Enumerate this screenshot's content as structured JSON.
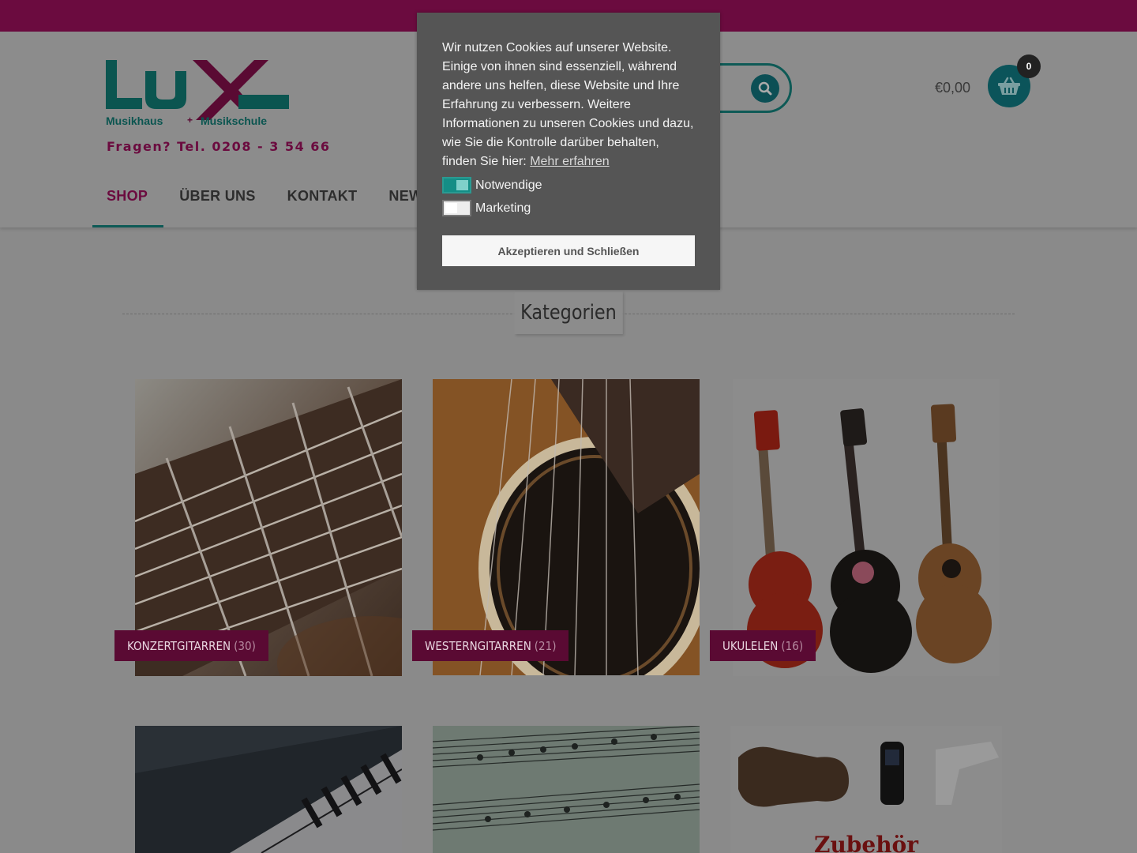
{
  "colors": {
    "brand_primary": "#6b0b3f",
    "brand_teal": "#0e5a56",
    "overlay": "#555555"
  },
  "logo": {
    "wordmark": "LUX",
    "left_text": "Musikhaus",
    "plus": "+",
    "right_text": "Musikschule"
  },
  "header": {
    "phone_text": "Fragen? Tel. 0208 - 3 54 66",
    "search": {
      "placeholder": "…"
    },
    "search_icon": "magnifier-icon",
    "cart": {
      "total": "€0,00",
      "count": "0",
      "icon": "basket-icon"
    }
  },
  "nav": {
    "items": [
      {
        "label": "SHOP",
        "active": true
      },
      {
        "label": "ÜBER UNS",
        "active": false
      },
      {
        "label": "KONTAKT",
        "active": false
      },
      {
        "label": "NEWS",
        "active": false
      }
    ]
  },
  "main": {
    "section_title": "Kategorien",
    "categories": [
      {
        "name": "KONZERTGITARREN",
        "count": "(30)"
      },
      {
        "name": "WESTERNGITARREN",
        "count": "(21)"
      },
      {
        "name": "UKULELEN",
        "count": "(16)"
      },
      {
        "name": "",
        "count": ""
      },
      {
        "name": "",
        "count": ""
      },
      {
        "name": "",
        "count": ""
      }
    ],
    "accessory_image_text": "Zubehör"
  },
  "cookie_banner": {
    "text": "Wir nutzen Cookies auf unserer Website. Einige von ihnen sind essenziell, während andere uns helfen, diese Website und Ihre Erfahrung zu verbessern. Weitere Informationen zu unseren Cookies und dazu, wie Sie die Kontrolle darüber behalten, finden Sie hier:",
    "link_text": "Mehr erfahren",
    "options": [
      {
        "label": "Notwendige",
        "checked": true
      },
      {
        "label": "Marketing",
        "checked": false
      }
    ],
    "accept_label": "Akzeptieren und Schließen"
  }
}
